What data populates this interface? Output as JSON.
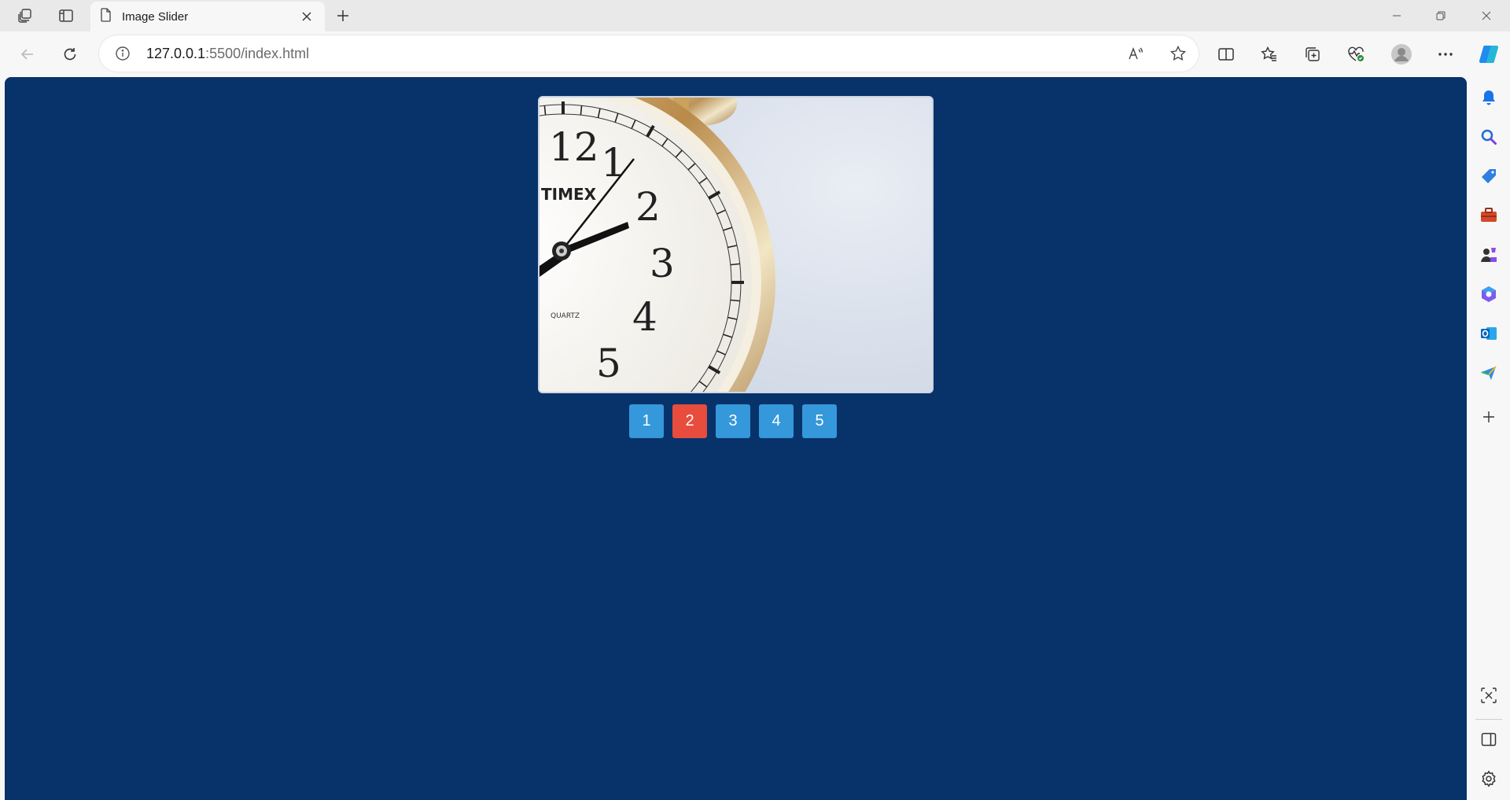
{
  "browser": {
    "tab": {
      "title": "Image Slider"
    },
    "address": {
      "host": "127.0.0.1",
      "rest": ":5500/index.html"
    }
  },
  "icons": {
    "tabstrip": [
      "workspaces-icon",
      "vertical-tabs-icon",
      "page-icon",
      "close-icon",
      "plus-icon"
    ],
    "window": [
      "minimize-icon",
      "restore-icon",
      "close-window-icon"
    ],
    "toolbar": [
      "back-icon",
      "refresh-icon",
      "info-icon",
      "read-aloud-icon",
      "favorite-star-icon",
      "split-screen-icon",
      "favorites-icon",
      "collections-icon",
      "browser-essentials-icon",
      "profile-icon",
      "more-icon",
      "copilot-icon"
    ],
    "sidebar": [
      "bell-icon",
      "search-icon",
      "shopping-tag-icon",
      "tools-icon",
      "games-icon",
      "microsoft-365-icon",
      "outlook-icon",
      "send-icon",
      "add-icon",
      "screenshot-icon",
      "sidebar-toggle-icon",
      "settings-icon"
    ]
  },
  "colors": {
    "page_background": "#08326a",
    "button": "#3498db",
    "button_active": "#e74c3c"
  },
  "slider": {
    "image": "alarm-clock-photo",
    "clock_texts": [
      "12",
      "1",
      "2",
      "3",
      "4",
      "5",
      "TIMEX",
      "QUARTZ"
    ],
    "buttons": [
      {
        "label": "1",
        "active": false
      },
      {
        "label": "2",
        "active": true
      },
      {
        "label": "3",
        "active": false
      },
      {
        "label": "4",
        "active": false
      },
      {
        "label": "5",
        "active": false
      }
    ]
  }
}
